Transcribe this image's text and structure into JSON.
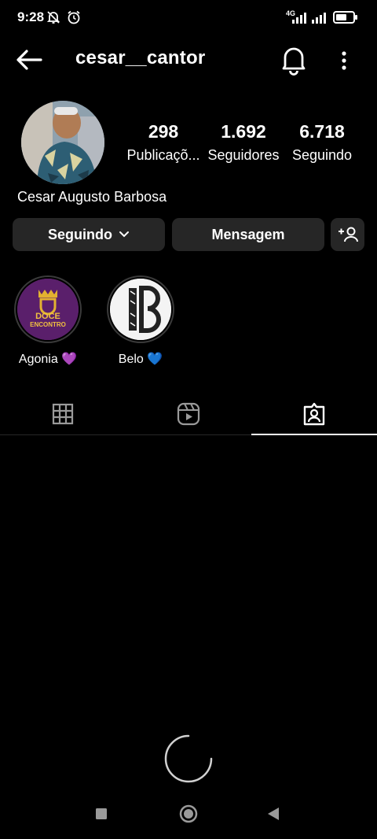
{
  "status": {
    "time": "9:28",
    "network": "4G"
  },
  "header": {
    "username": "cesar__cantor"
  },
  "stats": [
    {
      "value": "298",
      "label": "Publicaçõ..."
    },
    {
      "value": "1.692",
      "label": "Seguidores"
    },
    {
      "value": "6.718",
      "label": "Seguindo"
    }
  ],
  "profile": {
    "full_name": "Cesar Augusto Barbosa"
  },
  "buttons": {
    "following": "Seguindo",
    "message": "Mensagem"
  },
  "highlights": [
    {
      "label": "Agonia 💜",
      "cover_text_1": "DOCE",
      "cover_text_2": "ENCONTRO"
    },
    {
      "label": "Belo 💙",
      "cover_text": "B"
    }
  ],
  "colors": {
    "accent": "#ffffff",
    "button_bg": "#262626",
    "background": "#000000"
  }
}
